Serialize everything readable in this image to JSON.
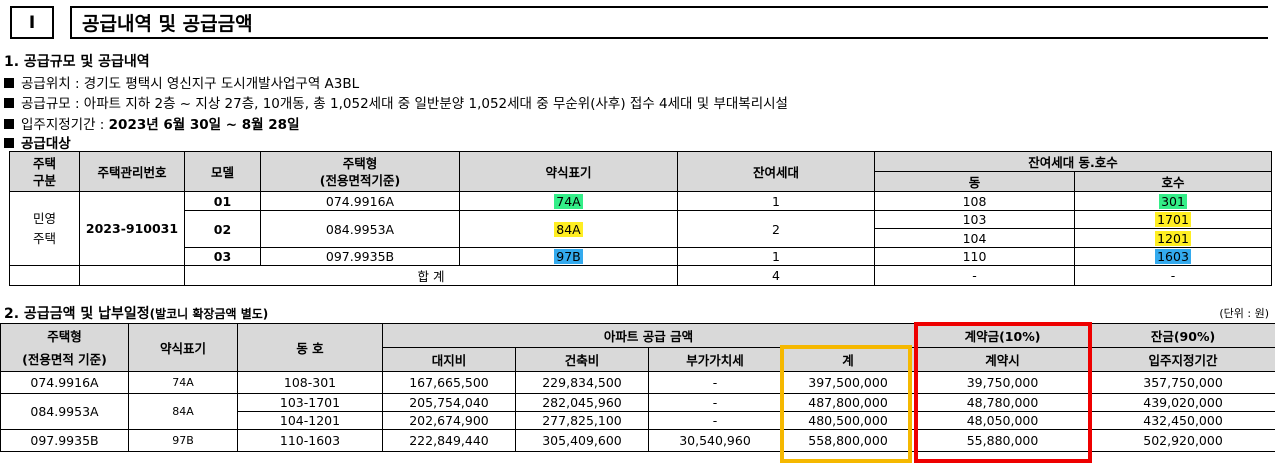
{
  "header": {
    "number": "I",
    "title": "공급내역 및 공급금액"
  },
  "section1": {
    "title": "1. 공급규모 및 공급내역",
    "location": "공급위치 : 경기도 평택시 영신지구 도시개발사업구역 A3BL",
    "scale": "공급규모 : 아파트 지하 2층 ~ 지상 27층, 10개동, 총 1,052세대 중 일반분양 1,052세대 중 무순위(사후) 접수 4세대 및 부대복리시설",
    "movein_label": "입주지정기간 : ",
    "movein_value": "2023년 6월 30일 ~ 8월 28일",
    "target_title": "공급대상"
  },
  "table1": {
    "h_type": "주택\n구분",
    "h_mgmt": "주택관리번호",
    "h_model": "모델",
    "h_housing": "주택형\n(전용면적기준)",
    "h_abbr": "약식표기",
    "h_remain": "잔여세대",
    "h_remain_units": "잔여세대 동.호수",
    "h_dong": "동",
    "h_ho": "호수",
    "type": "민영\n주택",
    "mgmt": "2023-910031",
    "rows": [
      {
        "model": "01",
        "housing": "074.9916A",
        "abbr": "74A",
        "abbr_color": "#33ee88",
        "remain": "1"
      },
      {
        "model": "02",
        "housing": "084.9953A",
        "abbr": "84A",
        "abbr_color": "#ffee22",
        "remain": "2"
      },
      {
        "model": "03",
        "housing": "097.9935B",
        "abbr": "97B",
        "abbr_color": "#33aaee",
        "remain": "1"
      }
    ],
    "units": [
      {
        "dong": "108",
        "ho": "301"
      },
      {
        "dong": "103",
        "ho": "1701"
      },
      {
        "dong": "104",
        "ho": "1201"
      },
      {
        "dong": "110",
        "ho": "1603"
      }
    ],
    "total_label": "합 계",
    "total_remain": "4",
    "total_dong": "-",
    "total_ho": "-"
  },
  "section2": {
    "title": "2. 공급금액 및 납부일정",
    "title_sub": "(발코니 확장금액 별도)",
    "unit": "(단위 : 원)"
  },
  "table2": {
    "h_housing": "주택형\n(전용면적 기준)",
    "h_abbr": "약식표기",
    "h_dongho": "동 호",
    "h_apt_price": "아파트 공급 금액",
    "h_land": "대지비",
    "h_building": "건축비",
    "h_vat": "부가가치세",
    "h_sum": "계",
    "h_deposit": "계약금(10%)",
    "h_deposit_when": "계약시",
    "h_balance": "잔금(90%)",
    "h_balance_when": "입주지정기간",
    "rows": [
      {
        "housing": "074.9916A",
        "abbr": "74A",
        "dongho": "108-301",
        "land": "167,665,500",
        "building": "229,834,500",
        "vat": "-",
        "sum": "397,500,000",
        "deposit": "39,750,000",
        "balance": "357,750,000"
      },
      {
        "housing": "084.9953A",
        "abbr": "84A",
        "dongho": "103-1701",
        "land": "205,754,040",
        "building": "282,045,960",
        "vat": "-",
        "sum": "487,800,000",
        "deposit": "48,780,000",
        "balance": "439,020,000"
      },
      {
        "dongho": "104-1201",
        "land": "202,674,900",
        "building": "277,825,100",
        "vat": "-",
        "sum": "480,500,000",
        "deposit": "48,050,000",
        "balance": "432,450,000"
      },
      {
        "housing": "097.9935B",
        "abbr": "97B",
        "dongho": "110-1603",
        "land": "222,849,440",
        "building": "305,409,600",
        "vat": "30,540,960",
        "sum": "558,800,000",
        "deposit": "55,880,000",
        "balance": "502,920,000"
      }
    ]
  },
  "colors": {
    "header_bg": "#d9d9d9",
    "orange_box": "#f5b800",
    "red_box": "#ee0000"
  }
}
